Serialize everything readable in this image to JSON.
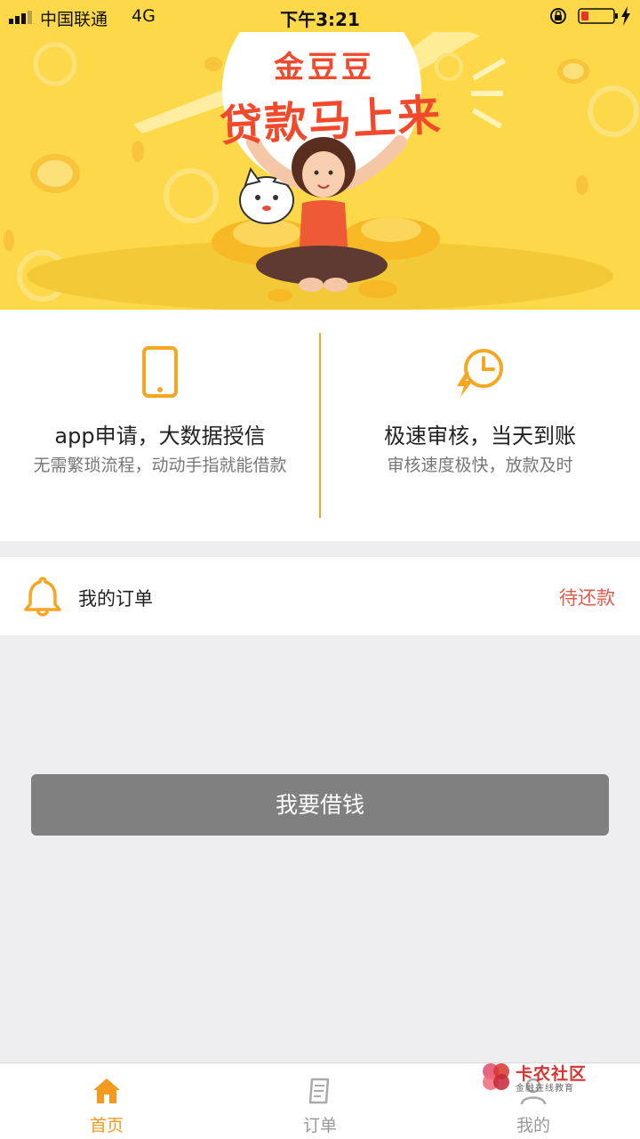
{
  "status_bar": {
    "carrier": "中国联通",
    "network": "4G",
    "time": "下午3:21"
  },
  "banner": {
    "brand": "金豆豆",
    "slogan": "贷款马上来"
  },
  "features": [
    {
      "icon": "phone-icon",
      "title": "app申请，大数据授信",
      "desc": "无需繁琐流程，动动手指就能借款"
    },
    {
      "icon": "fast-clock-icon",
      "title": "极速审核，当天到账",
      "desc": "审核速度极快，放款及时"
    }
  ],
  "orders": {
    "label": "我的订单",
    "status": "待还款"
  },
  "borrow_button": {
    "label": "我要借钱"
  },
  "tabbar": [
    {
      "label": "首页",
      "icon": "home-icon",
      "active": true
    },
    {
      "label": "订单",
      "icon": "order-icon",
      "active": false
    },
    {
      "label": "我的",
      "icon": "user-icon",
      "active": false
    }
  ],
  "watermark": {
    "title": "卡农社区",
    "subtitle": "金融在线教育"
  },
  "colors": {
    "banner_bg": "#FDD94A",
    "accent": "#F5A32A",
    "status_red": "#E25A4A",
    "tab_active": "#F49A1F",
    "button_bg": "#808080"
  }
}
